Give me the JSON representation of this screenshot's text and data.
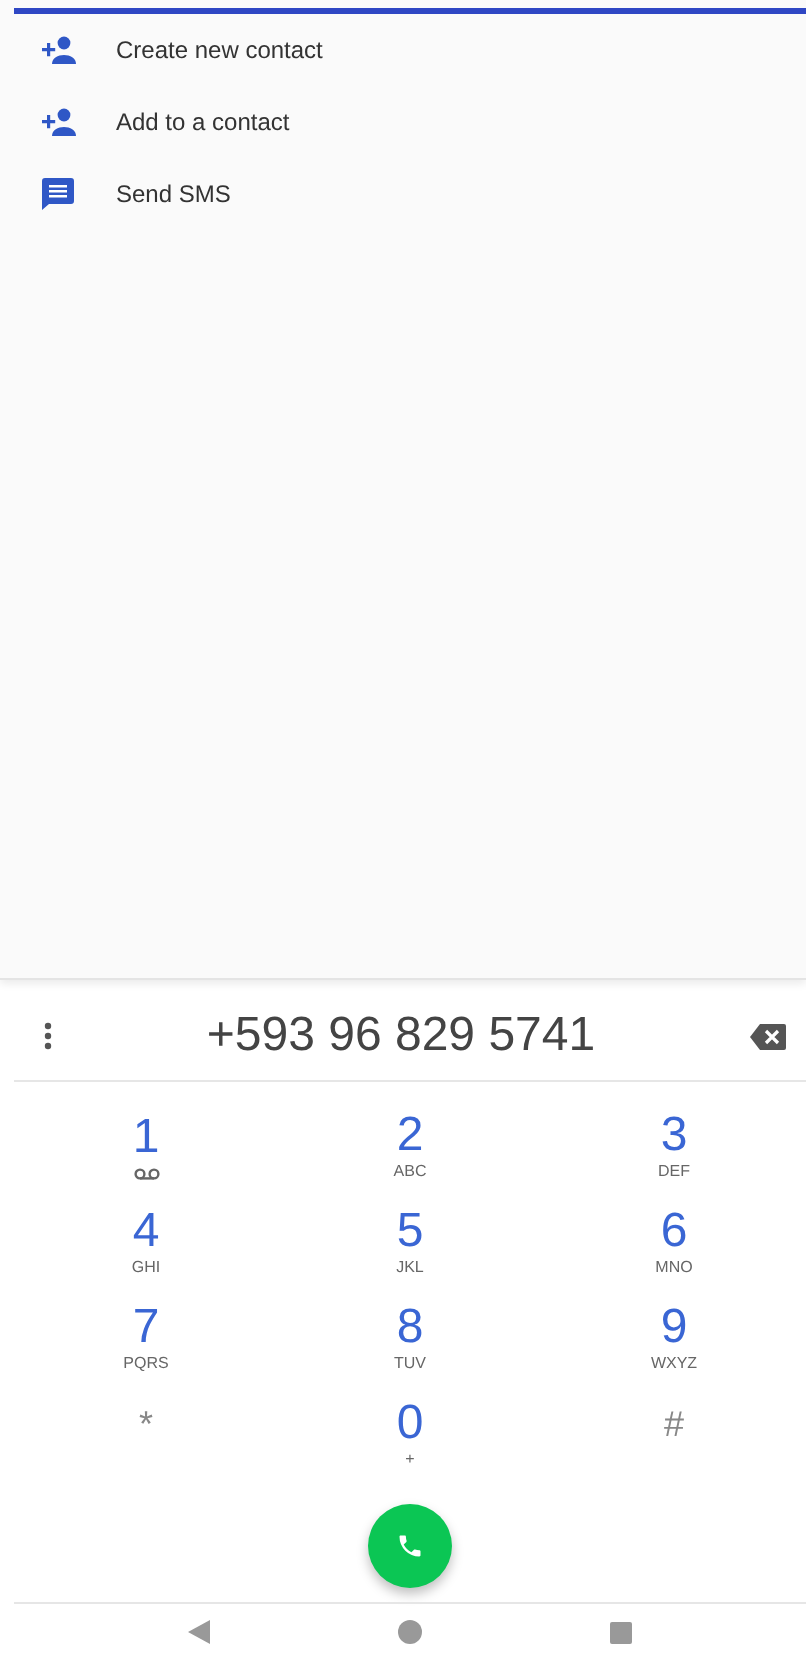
{
  "actions": [
    {
      "kind": "add-person",
      "label": "Create new contact"
    },
    {
      "kind": "add-person",
      "label": "Add to a contact"
    },
    {
      "kind": "message",
      "label": "Send SMS"
    }
  ],
  "dialer": {
    "number": "+593 96 829 5741"
  },
  "keys": [
    {
      "kind": "voicemail",
      "digit": "1"
    },
    {
      "kind": "letters",
      "digit": "2",
      "letters": "ABC"
    },
    {
      "kind": "letters",
      "digit": "3",
      "letters": "DEF"
    },
    {
      "kind": "letters",
      "digit": "4",
      "letters": "GHI"
    },
    {
      "kind": "letters",
      "digit": "5",
      "letters": "JKL"
    },
    {
      "kind": "letters",
      "digit": "6",
      "letters": "MNO"
    },
    {
      "kind": "letters",
      "digit": "7",
      "letters": "PQRS"
    },
    {
      "kind": "letters",
      "digit": "8",
      "letters": "TUV"
    },
    {
      "kind": "letters",
      "digit": "9",
      "letters": "WXYZ"
    },
    {
      "kind": "symbol",
      "digit": "*"
    },
    {
      "kind": "letters",
      "digit": "0",
      "letters": "+"
    },
    {
      "kind": "symbol",
      "digit": "#"
    }
  ]
}
